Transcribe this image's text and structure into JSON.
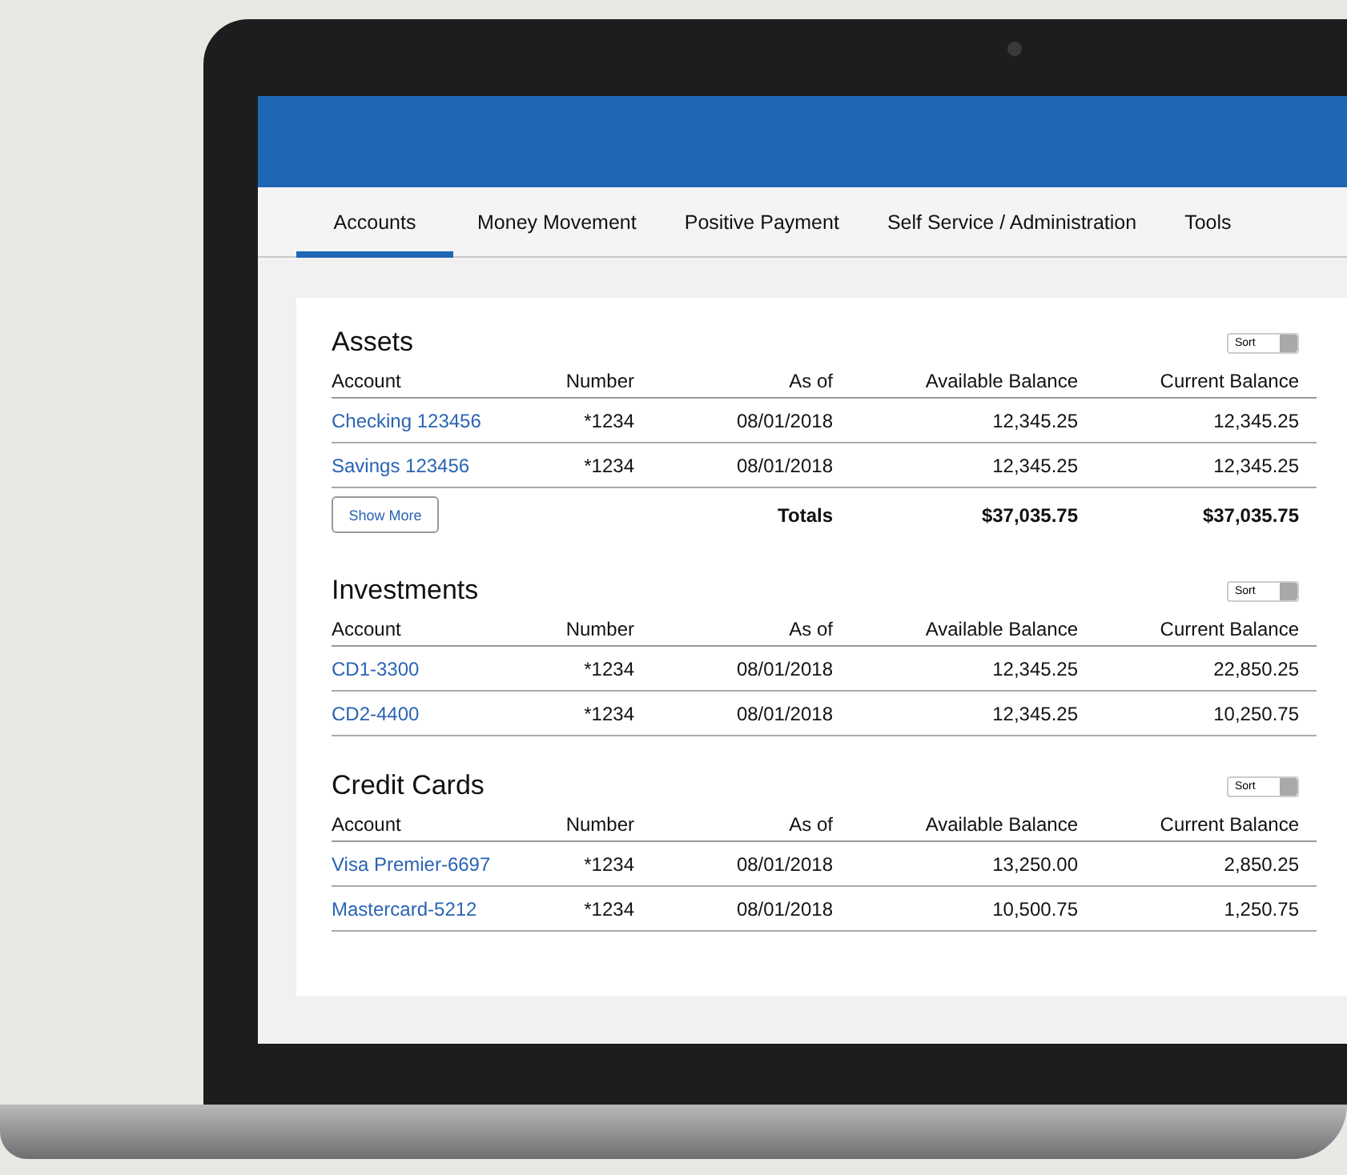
{
  "tabs": [
    {
      "label": "Accounts",
      "selected": true
    },
    {
      "label": "Money Movement",
      "selected": false
    },
    {
      "label": "Positive Payment",
      "selected": false
    },
    {
      "label": "Self Service / Administration",
      "selected": false
    },
    {
      "label": "Tools",
      "selected": false
    }
  ],
  "sections": [
    {
      "title": "Assets",
      "sort": "Sort",
      "columns": [
        "Account",
        "Number",
        "As of",
        "Available Balance",
        "Current Balance"
      ],
      "rows": [
        {
          "account": "Checking 123456",
          "number": "*1234",
          "as_of": "08/01/2018",
          "available": "12,345.25",
          "current": "12,345.25"
        },
        {
          "account": "Savings 123456",
          "number": "*1234",
          "as_of": "08/01/2018",
          "available": "12,345.25",
          "current": "12,345.25"
        }
      ],
      "show_more": "Show More",
      "totals": {
        "label": "Totals",
        "available": "$37,035.75",
        "current": "$37,035.75"
      }
    },
    {
      "title": "Investments",
      "sort": "Sort",
      "columns": [
        "Account",
        "Number",
        "As of",
        "Available Balance",
        "Current Balance"
      ],
      "rows": [
        {
          "account": "CD1-3300",
          "number": "*1234",
          "as_of": "08/01/2018",
          "available": "12,345.25",
          "current": "22,850.25"
        },
        {
          "account": "CD2-4400",
          "number": "*1234",
          "as_of": "08/01/2018",
          "available": "12,345.25",
          "current": "10,250.75"
        }
      ]
    },
    {
      "title": "Credit Cards",
      "sort": "Sort",
      "columns": [
        "Account",
        "Number",
        "As of",
        "Available Balance",
        "Current Balance"
      ],
      "rows": [
        {
          "account": "Visa Premier-6697",
          "number": "*1234",
          "as_of": "08/01/2018",
          "available": "13,250.00",
          "current": "2,850.25"
        },
        {
          "account": "Mastercard-5212",
          "number": "*1234",
          "as_of": "08/01/2018",
          "available": "10,500.75",
          "current": "1,250.75"
        }
      ]
    }
  ]
}
